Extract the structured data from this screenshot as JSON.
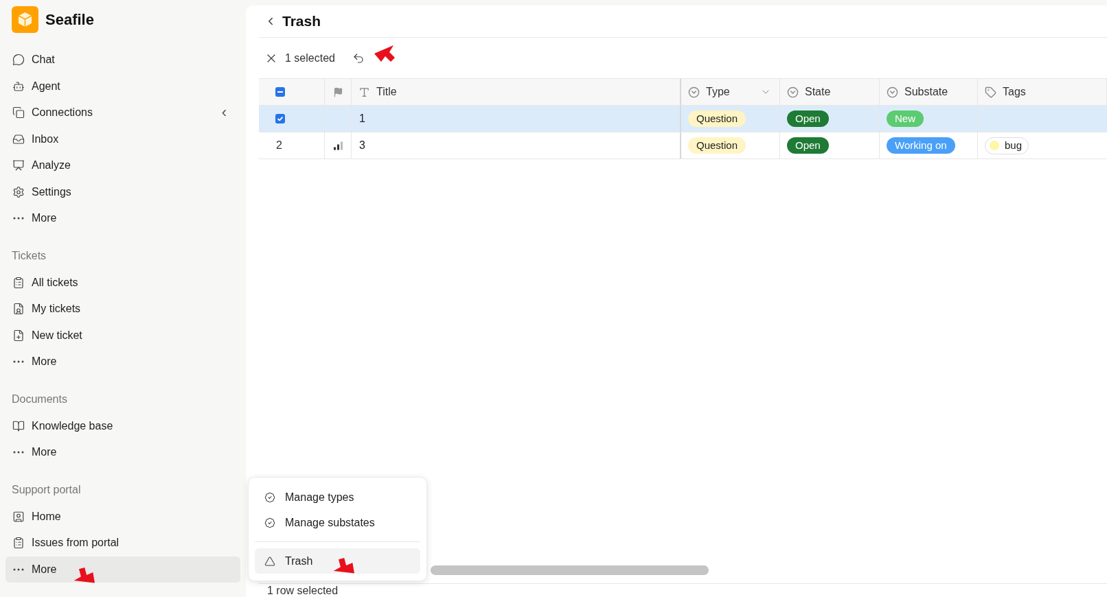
{
  "app": {
    "name": "Seafile"
  },
  "sidebar": {
    "collapse": "‹",
    "main_items": [
      {
        "label": "Chat",
        "selected": false
      },
      {
        "label": "Agent",
        "selected": false
      },
      {
        "label": "Connections",
        "selected": false
      },
      {
        "label": "Inbox",
        "selected": false
      },
      {
        "label": "Analyze",
        "selected": false
      },
      {
        "label": "Settings",
        "selected": false
      },
      {
        "label": "More",
        "selected": false
      }
    ],
    "sections": [
      {
        "title": "Tickets",
        "items": [
          {
            "label": "All tickets",
            "selected": false
          },
          {
            "label": "My tickets",
            "selected": false
          },
          {
            "label": "New ticket",
            "selected": false
          },
          {
            "label": "More",
            "selected": false
          }
        ]
      },
      {
        "title": "Documents",
        "items": [
          {
            "label": "Knowledge base",
            "selected": false
          },
          {
            "label": "More",
            "selected": false
          }
        ]
      },
      {
        "title": "Support portal",
        "items": [
          {
            "label": "Home",
            "selected": false
          },
          {
            "label": "Issues from portal",
            "selected": false
          },
          {
            "label": "More",
            "selected": true
          }
        ]
      }
    ]
  },
  "page": {
    "title": "Trash"
  },
  "toolbar": {
    "selection": "1 selected"
  },
  "table": {
    "select_all": {
      "checked": true,
      "partial": true
    },
    "columns": [
      {
        "label": "Title",
        "dropdown": false
      },
      {
        "label": "Type",
        "dropdown": true
      },
      {
        "label": "State",
        "dropdown": false
      },
      {
        "label": "Substate",
        "dropdown": false
      },
      {
        "label": "Tags",
        "dropdown": false
      }
    ],
    "rows": [
      {
        "selected": true,
        "priority": false,
        "title": "1",
        "type": {
          "label": "Question",
          "color": "#fff4c4"
        },
        "state": {
          "label": "Open",
          "color": "#1f7a35"
        },
        "substate": {
          "label": "New",
          "color": "#5ccb72"
        },
        "tags": []
      },
      {
        "selected": false,
        "number": "2",
        "priority": true,
        "title": "3",
        "type": {
          "label": "Question",
          "color": "#fff4c4"
        },
        "state": {
          "label": "Open",
          "color": "#1f7a35"
        },
        "substate": {
          "label": "Working on",
          "color": "#4aa0f7"
        },
        "tags": [
          {
            "label": "bug",
            "color": "#fdf7a6"
          }
        ]
      }
    ]
  },
  "menu": {
    "items": [
      {
        "label": "Manage types",
        "selected": false
      },
      {
        "label": "Manage substates",
        "selected": false
      },
      {
        "label": "Trash",
        "selected": true
      }
    ]
  },
  "status_bar": {
    "text": "1 row selected"
  }
}
